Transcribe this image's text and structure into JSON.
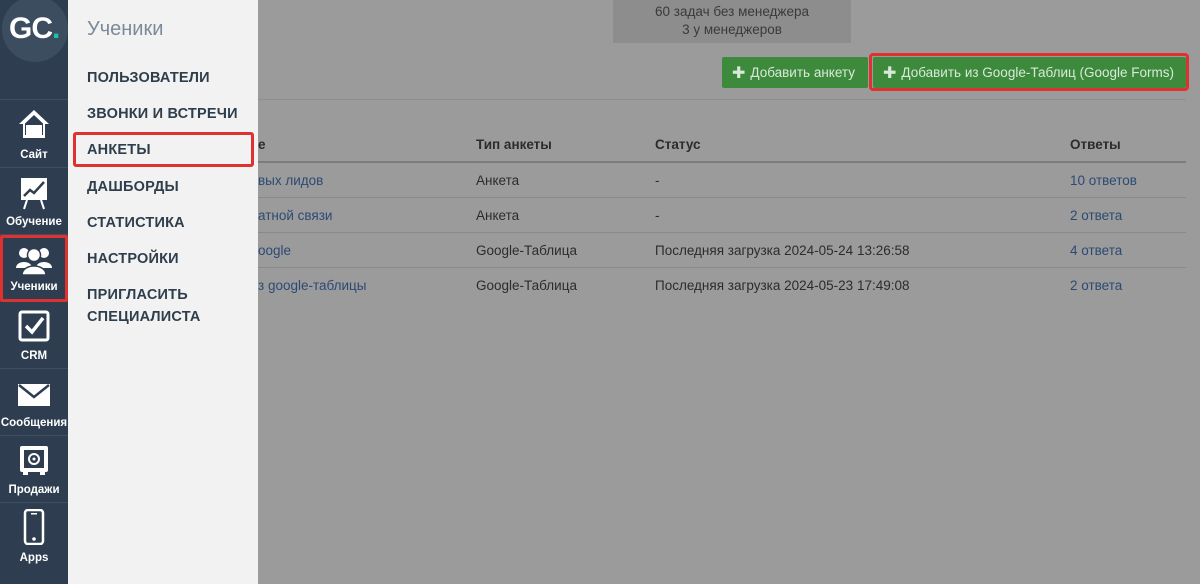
{
  "logo": {
    "text": "GC",
    "dot": "."
  },
  "rail": [
    {
      "label": "Сайт",
      "icon": "house-icon"
    },
    {
      "label": "Обучение",
      "icon": "chart-board-icon"
    },
    {
      "label": "Ученики",
      "icon": "users-icon",
      "active": true
    },
    {
      "label": "CRM",
      "icon": "checkbox-icon"
    },
    {
      "label": "Сообщения",
      "icon": "envelope-icon"
    },
    {
      "label": "Продажи",
      "icon": "safe-icon"
    },
    {
      "label": "Apps",
      "icon": "phone-icon"
    }
  ],
  "submenu": {
    "title": "Ученики",
    "items": [
      "ПОЛЬЗОВАТЕЛИ",
      "ЗВОНКИ И ВСТРЕЧИ",
      "АНКЕТЫ",
      "ДАШБОРДЫ",
      "СТАТИСТИКА",
      "НАСТРОЙКИ",
      "ПРИГЛАСИТЬ",
      "СПЕЦИАЛИСТА"
    ]
  },
  "stats": {
    "line1": "60 задач без менеджера",
    "line2": "3 у менеджеров"
  },
  "buttons": {
    "add_form": "Добавить анкету",
    "add_google": "Добавить из Google-Таблиц (Google Forms)"
  },
  "table": {
    "headers": {
      "name": "е",
      "type": "Тип анкеты",
      "status": "Статус",
      "answers": "Ответы"
    },
    "rows": [
      {
        "name": "вых лидов",
        "type": "Анкета",
        "status": "-",
        "answers": "10 ответов"
      },
      {
        "name": "атной связи",
        "type": "Анкета",
        "status": "-",
        "answers": "2 ответа"
      },
      {
        "name": "oogle",
        "type": "Google-Таблица",
        "status": "Последняя загрузка 2024-05-24 13:26:58",
        "answers": "4 ответа"
      },
      {
        "name": "з google-таблицы",
        "type": "Google-Таблица",
        "status": "Последняя загрузка 2024-05-23 17:49:08",
        "answers": "2 ответа"
      }
    ]
  },
  "colors": {
    "rail_bg": "#2e3e50",
    "accent_red": "#e03131",
    "button_green": "#3d8a3d",
    "logo_dot": "#1fc3a3"
  }
}
